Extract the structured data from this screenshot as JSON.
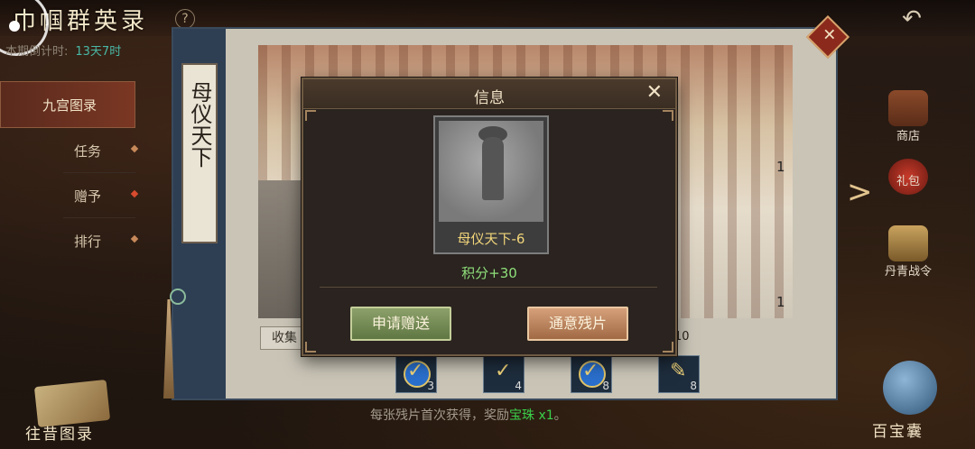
{
  "header": {
    "title": "巾帼群英录",
    "help": "?",
    "countdown_label": "本期倒计时:",
    "countdown_value": "13天7时"
  },
  "left_nav": {
    "items": [
      {
        "label": "九宫图录",
        "active": true
      },
      {
        "label": "任务"
      },
      {
        "label": "赠予"
      },
      {
        "label": "排行"
      }
    ]
  },
  "panel": {
    "scroll_title": "母仪天下",
    "scene_numbers": [
      "1",
      "1",
      "1"
    ],
    "collect_label": "收集",
    "collect_count": "10",
    "tiles": [
      {
        "count": "3",
        "icon": "check-badge-icon"
      },
      {
        "count": "4",
        "icon": "check-scroll-icon"
      },
      {
        "count": "8",
        "icon": "check-badge-icon"
      },
      {
        "count": "8",
        "icon": "scroll-icon"
      }
    ],
    "tip_prefix": "每张残片首次获得，奖励",
    "tip_highlight": "宝珠 x1",
    "tip_suffix": "。"
  },
  "right_menu": {
    "shop": "商店",
    "gift": "礼包",
    "pass": "丹青战令"
  },
  "bottom": {
    "left_label": "往昔图录",
    "right_label": "百宝囊"
  },
  "modal": {
    "title": "信息",
    "close": "✕",
    "card_name": "母仪天下-6",
    "score": "积分+30",
    "btn_request": "申请赠送",
    "btn_notify": "通意残片"
  }
}
